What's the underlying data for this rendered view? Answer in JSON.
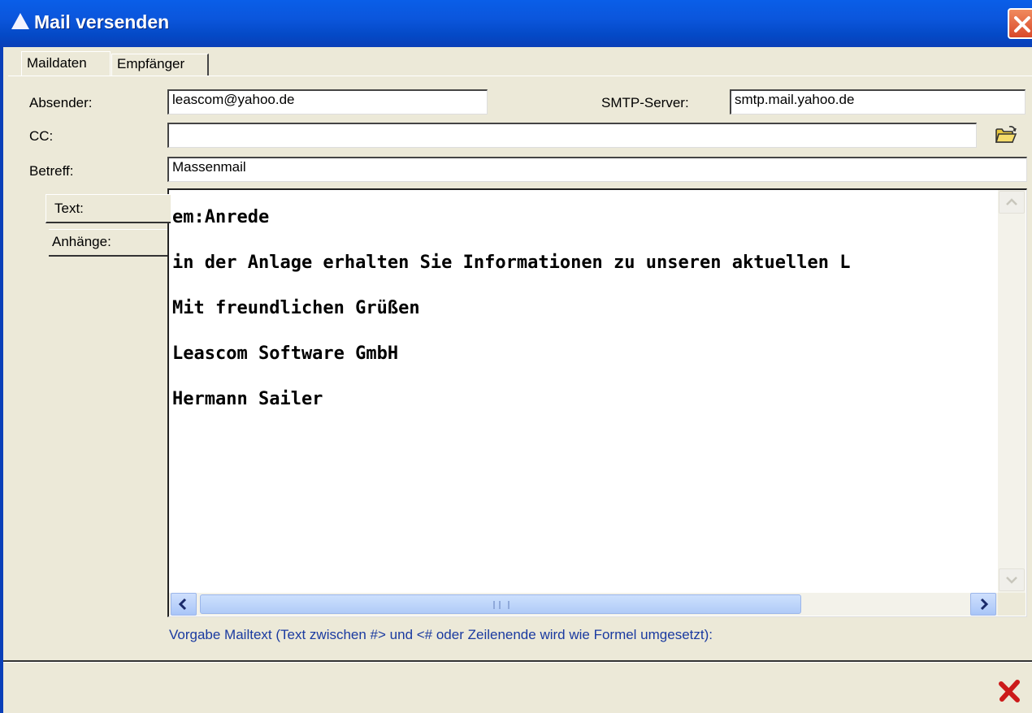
{
  "window": {
    "title": "Mail versenden"
  },
  "tabs": [
    {
      "label": "Maildaten",
      "active": true
    },
    {
      "label": "Empfänger",
      "active": false
    }
  ],
  "form": {
    "sender_label": "Absender:",
    "sender_value": "leascom@yahoo.de",
    "smtp_label": "SMTP-Server:",
    "smtp_value": "smtp.mail.yahoo.de",
    "cc_label": "CC:",
    "cc_value": "",
    "subject_label": "Betreff:",
    "subject_value": "Massenmail"
  },
  "side_tabs": [
    {
      "label": "Text:",
      "active": true
    },
    {
      "label": "Anhänge:",
      "active": false
    }
  ],
  "mail_text": {
    "lines": [
      "em:Anrede",
      "in der Anlage erhalten Sie Informationen zu unseren aktuellen L",
      "Mit freundlichen Grüßen",
      "Leascom Software GmbH",
      "Hermann Sailer"
    ]
  },
  "hint": "Vorgabe Mailtext (Text zwischen #> und <# oder Zeilenende wird wie Formel umgesetzt):",
  "icons": {
    "app": "app-icon",
    "close": "close-icon",
    "folder": "open-folder-icon",
    "cancel": "cancel-icon"
  },
  "colors": {
    "titlebar": "#0a56dc",
    "dialog_bg": "#ece9d8",
    "hint_text": "#1a3aa0",
    "cancel": "#cc1a1a"
  }
}
